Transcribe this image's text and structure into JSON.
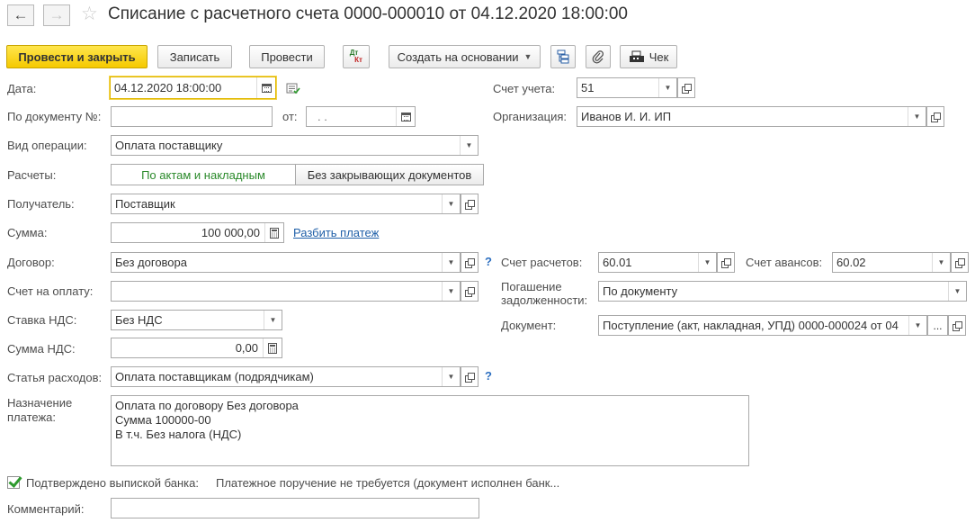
{
  "window": {
    "title": "Списание с расчетного счета 0000-000010 от 04.12.2020 18:00:00"
  },
  "toolbar": {
    "post_close_label": "Провести и закрыть",
    "save_label": "Записать",
    "post_label": "Провести",
    "dt_kt_top": "Дт",
    "dt_kt_bottom": "Кт",
    "create_based_label": "Создать на основании",
    "receipt_label": "Чек"
  },
  "form": {
    "date": {
      "label": "Дата:",
      "value": "04.12.2020 18:00:00"
    },
    "doc_number": {
      "label": "По документу №:",
      "value": ""
    },
    "doc_from": {
      "label": "от:",
      "value": " .  . "
    },
    "account": {
      "label": "Счет учета:",
      "value": "51"
    },
    "organization": {
      "label": "Организация:",
      "value": "Иванов И. И. ИП"
    },
    "operation_type": {
      "label": "Вид операции:",
      "value": "Оплата поставщику"
    },
    "settlements": {
      "label": "Расчеты:",
      "option_acts": "По актам и накладным",
      "option_none": "Без закрывающих документов"
    },
    "recipient": {
      "label": "Получатель:",
      "value": "Поставщик"
    },
    "amount": {
      "label": "Сумма:",
      "value": "100 000,00",
      "split_link": "Разбить платеж"
    },
    "contract": {
      "label": "Договор:",
      "value": "Без договора",
      "help": "?"
    },
    "settlement_account": {
      "label": "Счет расчетов:",
      "value": "60.01"
    },
    "advance_account": {
      "label": "Счет авансов:",
      "value": "60.02"
    },
    "invoice": {
      "label": "Счет на оплату:",
      "value": ""
    },
    "debt_repayment": {
      "label_line1": "Погашение",
      "label_line2": "задолженности:",
      "value": "По документу"
    },
    "document": {
      "label": "Документ:",
      "value": "Поступление (акт, накладная, УПД) 0000-000024 от 04",
      "more": "..."
    },
    "vat_rate": {
      "label": "Ставка НДС:",
      "value": "Без НДС"
    },
    "vat_amount": {
      "label": "Сумма НДС:",
      "value": "0,00"
    },
    "expense_item": {
      "label": "Статья расходов:",
      "value": "Оплата поставщикам (подрядчикам)",
      "help": "?"
    },
    "purpose": {
      "label_line1": "Назначение",
      "label_line2": "платежа:",
      "lines": [
        "Оплата по договору Без договора",
        "Сумма 100000-00",
        "В т.ч. Без налога (НДС)"
      ]
    },
    "bank_confirmed": {
      "label": "Подтверждено выпиской банка:",
      "checked": true,
      "note": "Платежное поручение не требуется (документ исполнен банк..."
    },
    "comment": {
      "label": "Комментарий:",
      "value": ""
    }
  },
  "colors": {
    "primary_button": "#f5c900",
    "focus_border": "#e0b700",
    "link": "#1f5fa8",
    "active_segment_text": "#2b8a2b",
    "help": "#2d6fc0"
  }
}
